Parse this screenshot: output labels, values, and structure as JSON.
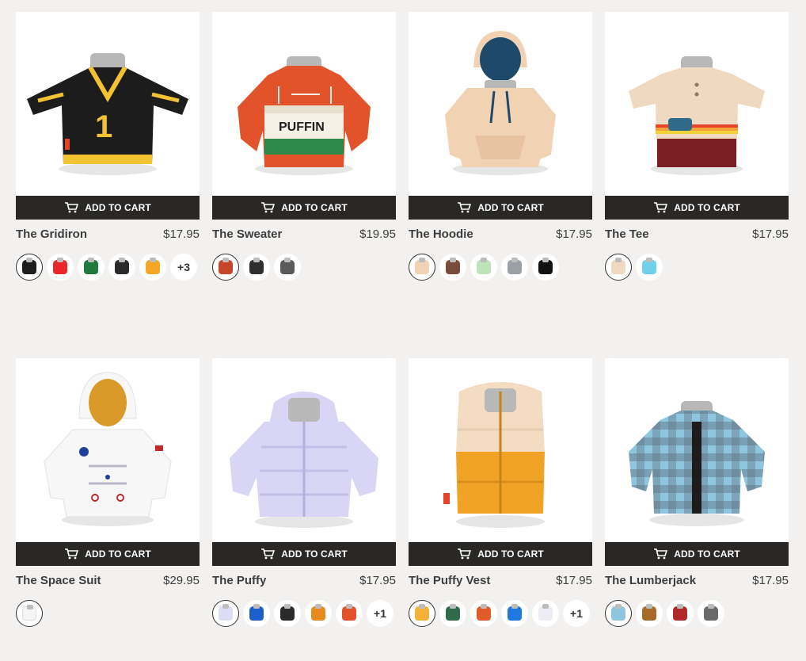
{
  "add_to_cart_label": "ADD TO CART",
  "products": [
    {
      "name": "The Gridiron",
      "price": "$17.95",
      "colors": [
        "#1e1e1e",
        "#e8272a",
        "#1f7a3c",
        "#2a2a2a",
        "#f5a623"
      ],
      "more": "+3"
    },
    {
      "name": "The Sweater",
      "price": "$19.95",
      "colors": [
        "#c4472a",
        "#2f2f2f",
        "#5a5a5a"
      ],
      "more": ""
    },
    {
      "name": "The Hoodie",
      "price": "$17.95",
      "colors": [
        "#f1d3b4",
        "#7a4a3a",
        "#bfe3b8",
        "#9aa0a6",
        "#111111"
      ],
      "more": ""
    },
    {
      "name": "The Tee",
      "price": "$17.95",
      "colors": [
        "#efd9c0",
        "#6fd0ea"
      ],
      "more": ""
    },
    {
      "name": "The Space Suit",
      "price": "$29.95",
      "colors": [
        "#f5f5f5"
      ],
      "more": ""
    },
    {
      "name": "The Puffy",
      "price": "$17.95",
      "colors": [
        "#dcdcf5",
        "#1b5fc9",
        "#2a2a2a",
        "#e68a1e",
        "#e3502a"
      ],
      "more": "+1"
    },
    {
      "name": "The Puffy Vest",
      "price": "$17.95",
      "colors": [
        "#f3b13a",
        "#2e6b4a",
        "#e05a2a",
        "#1e7ae0",
        "#ececf4"
      ],
      "more": "+1"
    },
    {
      "name": "The Lumberjack",
      "price": "$17.95",
      "colors": [
        "#8fc6df",
        "#a86a28",
        "#b02a2a",
        "#6a6a6a"
      ],
      "more": ""
    }
  ]
}
